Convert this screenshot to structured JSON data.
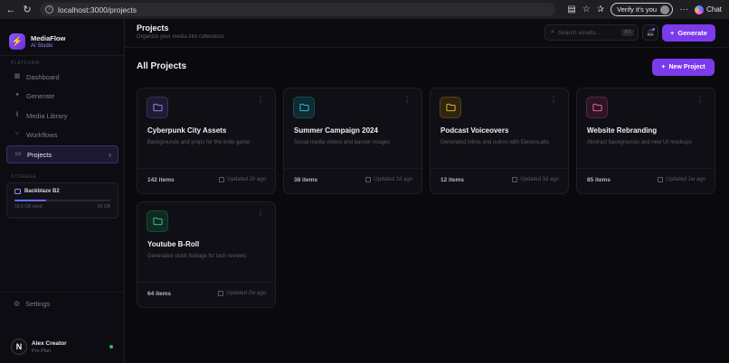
{
  "browser": {
    "url": "localhost:3000/projects",
    "verify_label": "Verify it's you",
    "chat_label": "Chat"
  },
  "brand": {
    "name": "MediaFlow",
    "subtitle": "AI Studio"
  },
  "sidebar": {
    "section_platform": "PLATFORM",
    "items": [
      {
        "label": "Dashboard",
        "icon": "grid-icon"
      },
      {
        "label": "Generate",
        "icon": "sparkle-icon"
      },
      {
        "label": "Media Library",
        "icon": "library-icon"
      },
      {
        "label": "Workflows",
        "icon": "workflow-icon"
      },
      {
        "label": "Projects",
        "icon": "folder-icon",
        "active": true
      }
    ],
    "section_storage": "STORAGE",
    "storage": {
      "name": "Backblaze B2",
      "used": "16.5 GB used",
      "total": "50 GB",
      "fraction": 0.33
    },
    "settings_label": "Settings",
    "user": {
      "initial": "N",
      "name": "Alex Creator",
      "plan": "Pro Plan"
    }
  },
  "header": {
    "title": "Projects",
    "subtitle": "Organize your media into collections",
    "search_placeholder": "Search assets...",
    "search_shortcut": "⌘K",
    "generate_label": "Generate"
  },
  "main": {
    "title": "All Projects",
    "new_project_label": "New Project"
  },
  "projects": [
    {
      "title": "Cyberpunk City Assets",
      "description": "Backgrounds and props for the indie game",
      "count": "142 items",
      "updated": "Updated 2h ago",
      "color": "#a78bfa",
      "bg": "#1f1a33"
    },
    {
      "title": "Summer Campaign 2024",
      "description": "Social media videos and banner images",
      "count": "38 items",
      "updated": "Updated 1d ago",
      "color": "#22d3ee",
      "bg": "#0f2a30"
    },
    {
      "title": "Podcast Voiceovers",
      "description": "Generated intros and outros with ElevenLabs",
      "count": "12 items",
      "updated": "Updated 3d ago",
      "color": "#fbbf24",
      "bg": "#2e2410"
    },
    {
      "title": "Website Rebranding",
      "description": "Abstract backgrounds and new UI mockups",
      "count": "85 items",
      "updated": "Updated 1w ago",
      "color": "#f472b6",
      "bg": "#2e1424"
    },
    {
      "title": "Youtube B-Roll",
      "description": "Generated stock footage for tech reviews",
      "count": "64 items",
      "updated": "Updated 2w ago",
      "color": "#34d399",
      "bg": "#0f2a1f"
    }
  ]
}
